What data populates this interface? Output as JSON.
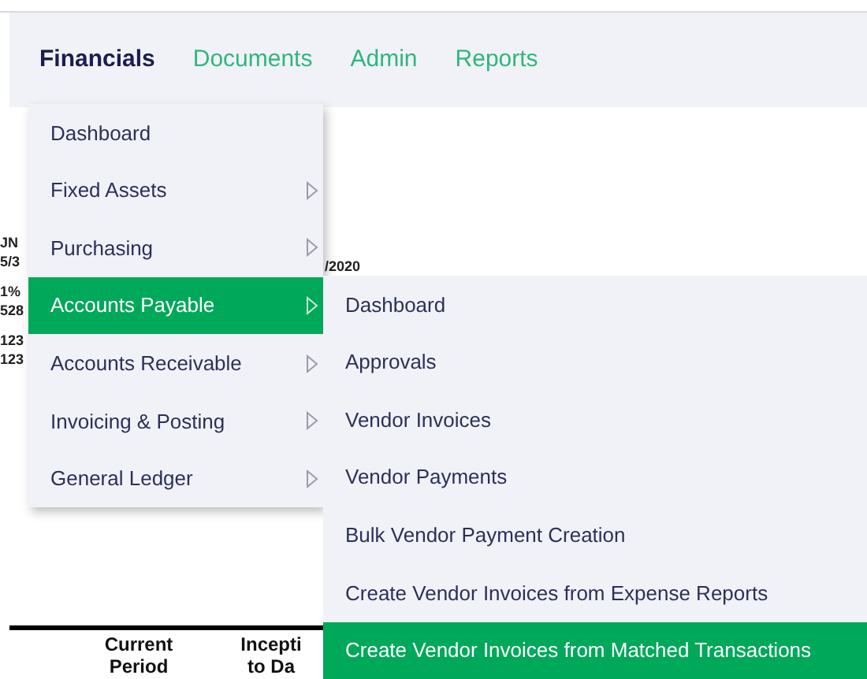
{
  "nav": {
    "tabs": [
      {
        "label": "Financials",
        "selected": true
      },
      {
        "label": "Documents",
        "selected": false
      },
      {
        "label": "Admin",
        "selected": false
      },
      {
        "label": "Reports",
        "selected": false
      }
    ]
  },
  "report": {
    "left_fragments": [
      "JN",
      "5/3",
      "1%",
      "528",
      "123",
      "123"
    ],
    "date_fragment": "/2020",
    "columns": [
      {
        "lines": [
          "Current",
          "Period"
        ]
      },
      {
        "lines": [
          "Incepti",
          "to Da"
        ]
      }
    ]
  },
  "menu": {
    "items": [
      {
        "label": "Dashboard",
        "has_submenu": false,
        "selected": false
      },
      {
        "label": "Fixed Assets",
        "has_submenu": true,
        "selected": false
      },
      {
        "label": "Purchasing",
        "has_submenu": true,
        "selected": false
      },
      {
        "label": "Accounts Payable",
        "has_submenu": true,
        "selected": true
      },
      {
        "label": "Accounts Receivable",
        "has_submenu": true,
        "selected": false
      },
      {
        "label": "Invoicing & Posting",
        "has_submenu": true,
        "selected": false
      },
      {
        "label": "General Ledger",
        "has_submenu": true,
        "selected": false
      }
    ]
  },
  "submenu": {
    "items": [
      {
        "label": "Dashboard",
        "selected": false
      },
      {
        "label": "Approvals",
        "selected": false
      },
      {
        "label": "Vendor Invoices",
        "selected": false
      },
      {
        "label": "Vendor Payments",
        "selected": false
      },
      {
        "label": "Bulk Vendor Payment Creation",
        "selected": false
      },
      {
        "label": "Create Vendor Invoices from Expense Reports",
        "selected": false
      },
      {
        "label": "Create Vendor Invoices from Matched Transactions",
        "selected": true
      }
    ]
  }
}
